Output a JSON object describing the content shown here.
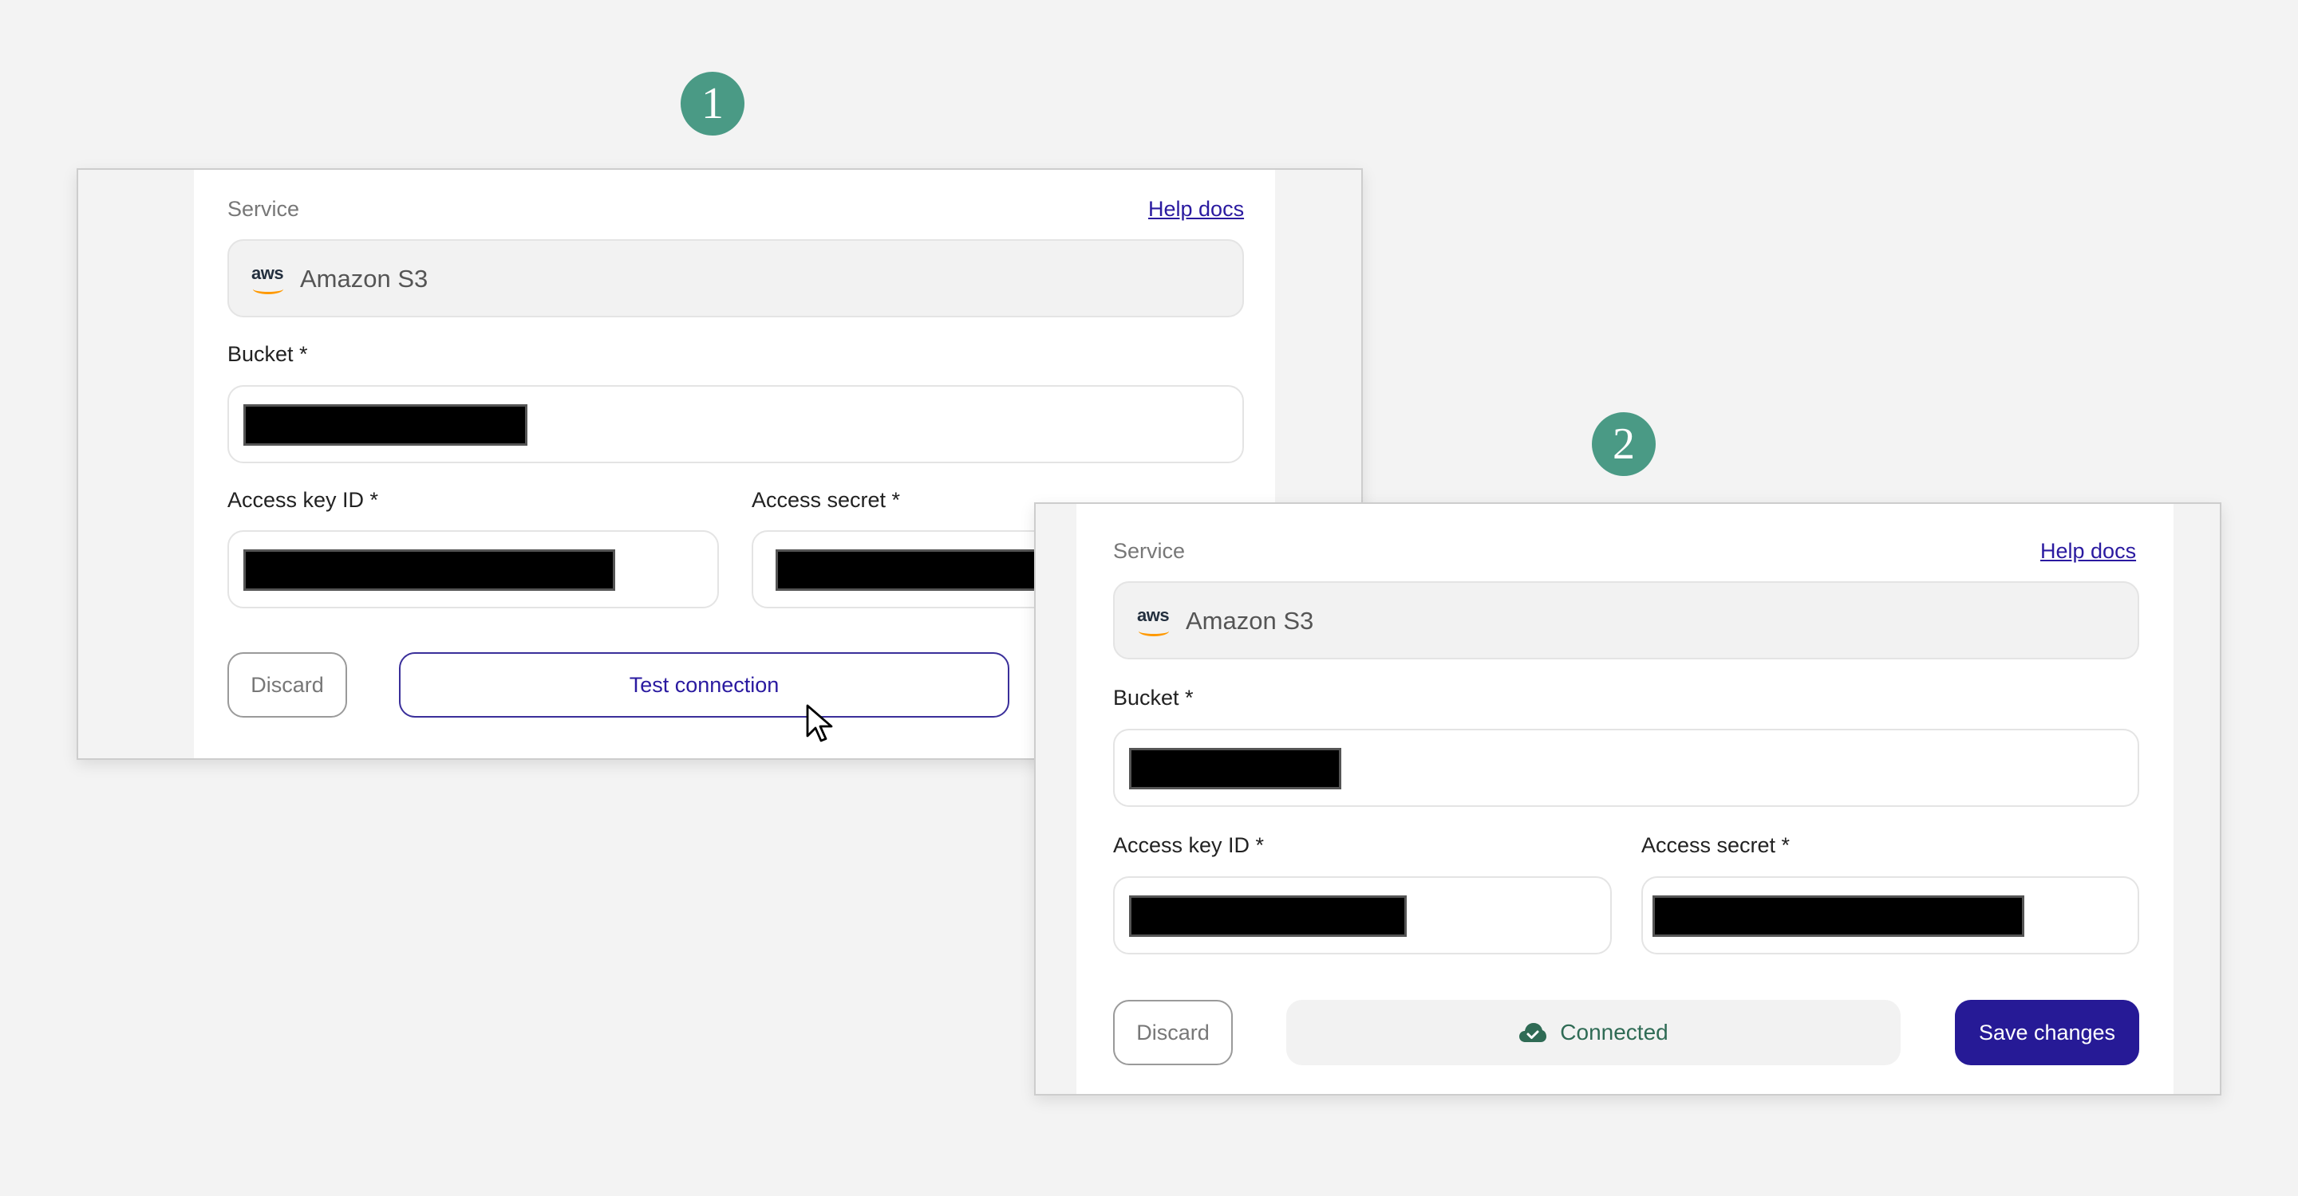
{
  "steps": [
    {
      "badge": "1",
      "service_label": "Service",
      "help_link": "Help docs",
      "service_value": "Amazon S3",
      "service_icon": "aws-logo-icon",
      "bucket_label": "Bucket *",
      "bucket_value": "[redacted]",
      "access_key_label": "Access key ID *",
      "access_key_value": "[redacted]",
      "access_secret_label": "Access secret *",
      "access_secret_value": "[redacted]",
      "discard_label": "Discard",
      "test_label": "Test connection"
    },
    {
      "badge": "2",
      "service_label": "Service",
      "help_link": "Help docs",
      "service_value": "Amazon S3",
      "service_icon": "aws-logo-icon",
      "bucket_label": "Bucket *",
      "bucket_value": "[redacted]",
      "access_key_label": "Access key ID *",
      "access_key_value": "[redacted]",
      "access_secret_label": "Access secret *",
      "access_secret_value": "[redacted]",
      "discard_label": "Discard",
      "status_label": "Connected",
      "status_icon": "cloud-check-icon",
      "save_label": "Save changes"
    }
  ],
  "colors": {
    "badge": "#4a9a85",
    "link": "#2a1aa0",
    "primary": "#261a96",
    "success": "#2f6b55",
    "aws_orange": "#ff9900"
  }
}
